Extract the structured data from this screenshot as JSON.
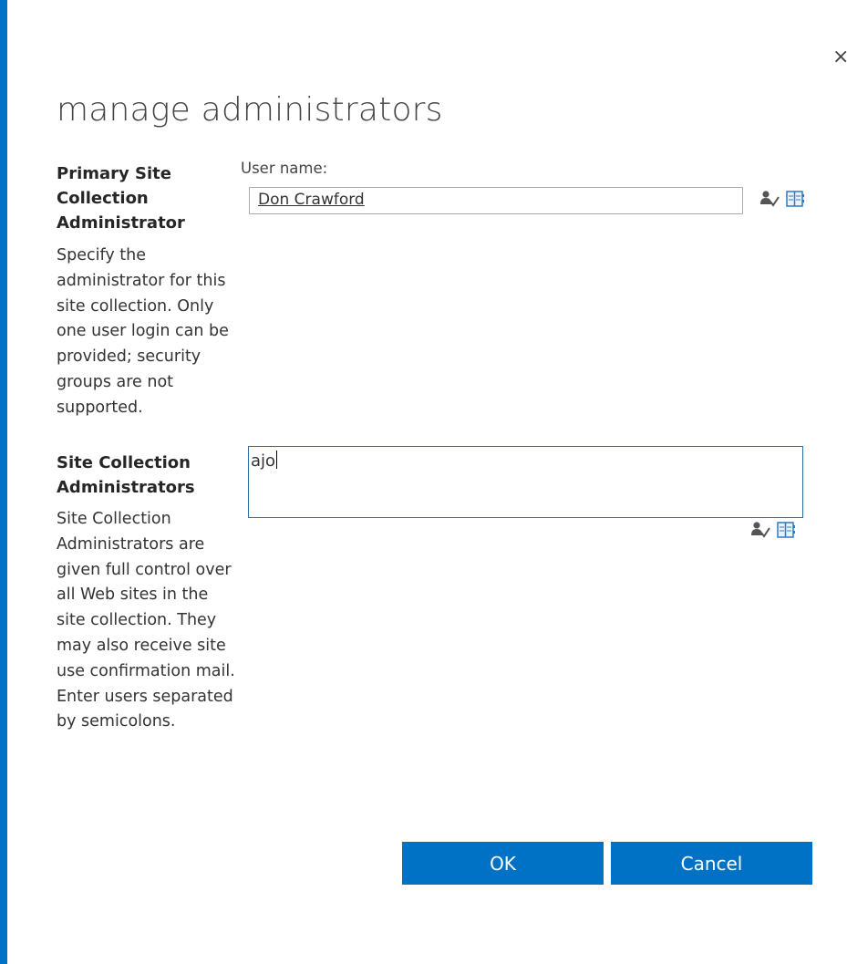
{
  "dialog": {
    "title": "manage administrators",
    "close_glyph": "×"
  },
  "primary_section": {
    "heading": "Primary Site Collection Administrator",
    "description": "Specify the administrator for this site collection. Only one user login can be provided; security groups are not supported.",
    "field_label": "User name:",
    "user_value": "Don Crawford",
    "icons": [
      "check-names-icon",
      "browse-address-book-icon"
    ]
  },
  "admins_section": {
    "heading": "Site Collection Administrators",
    "description": "Site Collection Administrators are given full control over all Web sites in the site collection. They may also receive site use confirmation mail. Enter users separated by semicolons.",
    "typed_value": "ajo",
    "icons": [
      "check-names-icon",
      "browse-address-book-icon"
    ]
  },
  "buttons": {
    "ok_label": "OK",
    "cancel_label": "Cancel"
  },
  "colors": {
    "accent": "#0072c6",
    "focus_border": "#2a6faa"
  }
}
